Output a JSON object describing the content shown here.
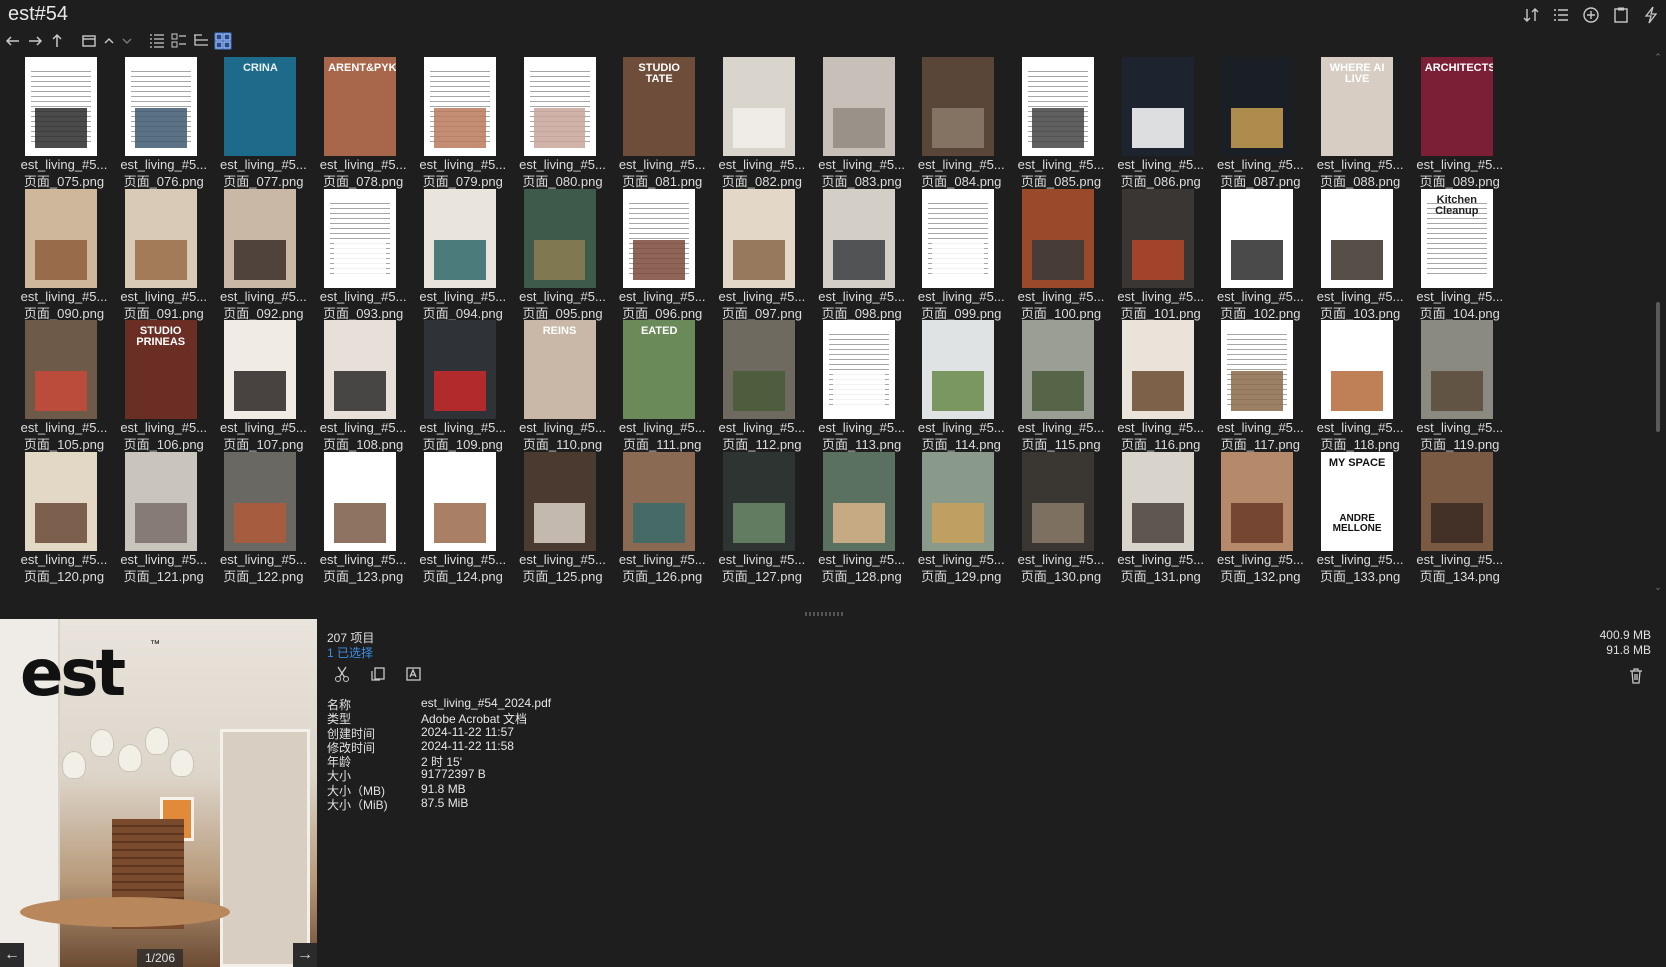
{
  "window": {
    "title": "est#54"
  },
  "grid": {
    "name_prefix": "est_living_#5...",
    "rows": [
      [
        {
          "page": "页面_075.png",
          "bg": "#ffffff",
          "lines": true,
          "art": "#2b2b2b"
        },
        {
          "page": "页面_076.png",
          "bg": "#ffffff",
          "lines": true,
          "art": "#3e5a6e"
        },
        {
          "page": "页面_077.png",
          "bg": "#1d6a8a",
          "label": "CRINA",
          "label_color": "#e8f2f5"
        },
        {
          "page": "页面_078.png",
          "bg": "#a8664a",
          "label": "ARENT&PYKE",
          "label_color": "#ffffff"
        },
        {
          "page": "页面_079.png",
          "bg": "#ffffff",
          "lines": true,
          "art": "#b97a5a"
        },
        {
          "page": "页面_080.png",
          "bg": "#ffffff",
          "lines": true,
          "art": "#c8a49a"
        },
        {
          "page": "页面_081.png",
          "bg": "#6e4e3a",
          "label": "STUDIO TATE",
          "label_color": "#ffffff"
        },
        {
          "page": "页面_082.png",
          "bg": "#d9d4cc",
          "art": "#f2f0ec"
        },
        {
          "page": "页面_083.png",
          "bg": "#c6c0b8",
          "art": "#8f8980"
        },
        {
          "page": "页面_084.png",
          "bg": "#5a4638",
          "art": "#8c7a6a"
        },
        {
          "page": "页面_085.png",
          "bg": "#ffffff",
          "lines": true,
          "art": "#444444"
        },
        {
          "page": "页面_086.png",
          "bg": "#1d2430",
          "art": "#ffffff"
        },
        {
          "page": "页面_087.png",
          "bg": "#1a1f26",
          "art": "#c9a055"
        },
        {
          "page": "页面_088.png",
          "bg": "#d8cdc2",
          "label": "WHERE AI LIVE",
          "label_color": "#ffffff"
        },
        {
          "page": "页面_089.png",
          "bg": "#7a1f35",
          "label": "ARCHITECTS",
          "label_color": "#ffffff"
        }
      ],
      [
        {
          "page": "页面_090.png",
          "bg": "#cfb79c",
          "art": "#8e5f3d"
        },
        {
          "page": "页面_091.png",
          "bg": "#d8cab6",
          "art": "#9a6d48"
        },
        {
          "page": "页面_092.png",
          "bg": "#c9b8a6",
          "art": "#3b2e28"
        },
        {
          "page": "页面_093.png",
          "bg": "#ffffff",
          "lines": true,
          "art": "#ffffff"
        },
        {
          "page": "页面_094.png",
          "bg": "#e9e5dd",
          "art": "#2f6a6a"
        },
        {
          "page": "页面_095.png",
          "bg": "#3e5a4a",
          "art": "#8c7e52"
        },
        {
          "page": "页面_096.png",
          "bg": "#ffffff",
          "lines": true,
          "art": "#7a4a3a"
        },
        {
          "page": "页面_097.png",
          "bg": "#e3d8c8",
          "art": "#8a6a4a"
        },
        {
          "page": "页面_098.png",
          "bg": "#d3cec6",
          "art": "#3a3d40"
        },
        {
          "page": "页面_099.png",
          "bg": "#ffffff",
          "lines": true,
          "art": "#ffffff"
        },
        {
          "page": "页面_100.png",
          "bg": "#9a4a2a",
          "art": "#3a3a3a"
        },
        {
          "page": "页面_101.png",
          "bg": "#3a3634",
          "art": "#b5452a"
        },
        {
          "page": "页面_102.png",
          "bg": "#ffffff",
          "art": "#2a2a2a"
        },
        {
          "page": "页面_103.png",
          "bg": "#ffffff",
          "art": "#3a2f28"
        },
        {
          "page": "页面_104.png",
          "bg": "#ffffff",
          "lines": true,
          "label": "Kitchen Cleanup",
          "label_color": "#222222"
        }
      ],
      [
        {
          "page": "页面_105.png",
          "bg": "#6e5a48",
          "art": "#c94a3a"
        },
        {
          "page": "页面_106.png",
          "bg": "#6a2e24",
          "label": "STUDIO PRINEAS",
          "label_color": "#ffffff"
        },
        {
          "page": "页面_107.png",
          "bg": "#f0ebe4",
          "art": "#2a2524"
        },
        {
          "page": "页面_108.png",
          "bg": "#e6e0d8",
          "art": "#2a2a2a"
        },
        {
          "page": "页面_109.png",
          "bg": "#2f3236",
          "art": "#c92a2a"
        },
        {
          "page": "页面_110.png",
          "bg": "#c9b8a8",
          "label": "REINS",
          "label_color": "#ffffff"
        },
        {
          "page": "页面_111.png",
          "bg": "#6a8a5a",
          "label": "EATED",
          "label_color": "#ffffff"
        },
        {
          "page": "页面_112.png",
          "bg": "#6e6a60",
          "art": "#4a5a3a"
        },
        {
          "page": "页面_113.png",
          "bg": "#ffffff",
          "lines": true,
          "art": "#ffffff"
        },
        {
          "page": "页面_114.png",
          "bg": "#dfe3e4",
          "art": "#6a8a4a"
        },
        {
          "page": "页面_115.png",
          "bg": "#9a9e94",
          "art": "#4a5a3a"
        },
        {
          "page": "页面_116.png",
          "bg": "#e9e3da",
          "art": "#6a4a2e"
        },
        {
          "page": "页面_117.png",
          "bg": "#ffffff",
          "lines": true,
          "art": "#8a6a4a"
        },
        {
          "page": "页面_118.png",
          "bg": "#ffffff",
          "art": "#b56a3a"
        },
        {
          "page": "页面_119.png",
          "bg": "#8a8a80",
          "art": "#5a4a3a"
        }
      ],
      [
        {
          "page": "页面_120.png",
          "bg": "#e3d7c6",
          "art": "#6a4a36"
        },
        {
          "page": "页面_121.png",
          "bg": "#c9c4bc",
          "art": "#7a7068"
        },
        {
          "page": "页面_122.png",
          "bg": "#6a6862",
          "art": "#b05a3a"
        },
        {
          "page": "页面_123.png",
          "bg": "#ffffff",
          "art": "#7a5a48"
        },
        {
          "page": "页面_124.png",
          "bg": "#ffffff",
          "art": "#9a6a4a"
        },
        {
          "page": "页面_125.png",
          "bg": "#4a3a30",
          "art": "#d8d0c6"
        },
        {
          "page": "页面_126.png",
          "bg": "#8a6a52",
          "art": "#3a6a6a"
        },
        {
          "page": "页面_127.png",
          "bg": "#2e3432",
          "art": "#6a8a6a"
        },
        {
          "page": "页面_128.png",
          "bg": "#5a7060",
          "art": "#d8b48a"
        },
        {
          "page": "页面_129.png",
          "bg": "#8a9a8a",
          "art": "#c9a05a"
        },
        {
          "page": "页面_130.png",
          "bg": "#3a3632",
          "art": "#8a7a68"
        },
        {
          "page": "页面_131.png",
          "bg": "#d8d4cc",
          "art": "#4a4038"
        },
        {
          "page": "页面_132.png",
          "bg": "#b48a6a",
          "art": "#6a3a28"
        },
        {
          "page": "页面_133.png",
          "bg": "#ffffff",
          "label": "MY SPACE",
          "label2": "ANDRE MELLONE",
          "label_color": "#111111"
        },
        {
          "page": "页面_134.png",
          "bg": "#7a5a42",
          "art": "#3a2a22"
        }
      ]
    ]
  },
  "preview": {
    "brand": "est",
    "trademark": "™",
    "counter": "1/206",
    "prev_label": "←",
    "next_label": "→"
  },
  "info": {
    "count": "207 项目",
    "selected": "1 已选择",
    "size_total": "400.9 MB",
    "size_selected": "91.8 MB",
    "props": [
      {
        "k": "名称",
        "v": "est_living_#54_2024.pdf"
      },
      {
        "k": "类型",
        "v": "Adobe Acrobat 文档"
      },
      {
        "k": "创建时间",
        "v": "2024-11-22  11:57"
      },
      {
        "k": "修改时间",
        "v": "2024-11-22  11:58"
      },
      {
        "k": "年龄",
        "v": "2 时 15'"
      },
      {
        "k": "大小",
        "v": "91772397 B"
      },
      {
        "k": "大小（MB)",
        "v": "91.8 MB"
      },
      {
        "k": "大小（MiB)",
        "v": "87.5 MiB"
      }
    ]
  }
}
